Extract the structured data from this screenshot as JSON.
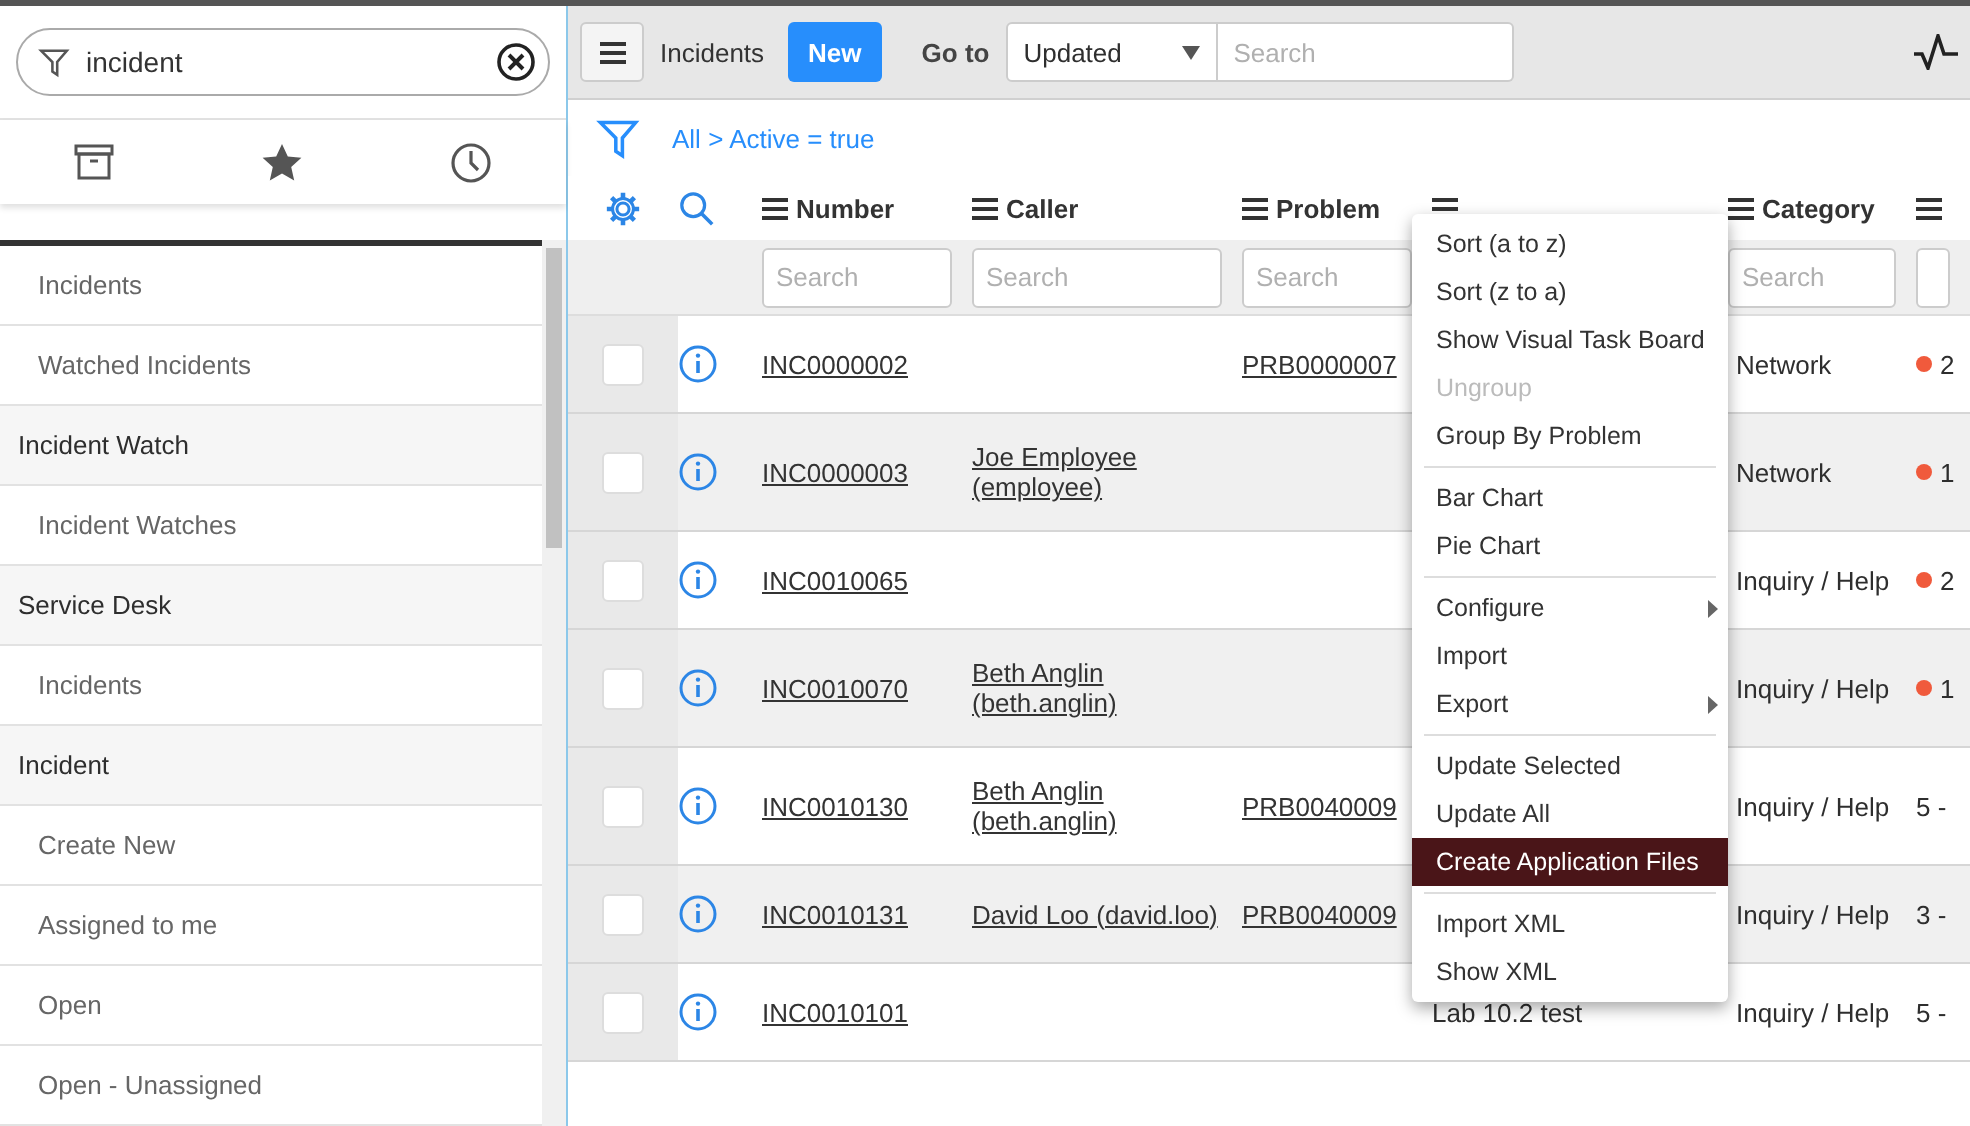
{
  "sidebar": {
    "filter": {
      "value": "incident"
    },
    "items": [
      {
        "kind": "module",
        "label": "Incidents"
      },
      {
        "kind": "module",
        "label": "Watched Incidents"
      },
      {
        "kind": "header",
        "label": "Incident Watch"
      },
      {
        "kind": "module",
        "label": "Incident Watches"
      },
      {
        "kind": "header",
        "label": "Service Desk"
      },
      {
        "kind": "module",
        "label": "Incidents"
      },
      {
        "kind": "header",
        "label": "Incident"
      },
      {
        "kind": "module",
        "label": "Create New"
      },
      {
        "kind": "module",
        "label": "Assigned to me"
      },
      {
        "kind": "module",
        "label": "Open"
      },
      {
        "kind": "module",
        "label": "Open - Unassigned"
      }
    ]
  },
  "toolbar": {
    "title": "Incidents",
    "new_button": "New",
    "goto_label": "Go to",
    "goto_field": "Updated",
    "search": {
      "placeholder": "Search"
    }
  },
  "breadcrumb": {
    "all": "All",
    "separator": ">",
    "condition": "Active = true"
  },
  "table": {
    "columns": [
      {
        "label": "Number",
        "placeholder": "Search"
      },
      {
        "label": "Caller",
        "placeholder": "Search"
      },
      {
        "label": "Problem",
        "placeholder": "Search"
      },
      {},
      {
        "label": "Category",
        "placeholder": "Search"
      },
      {}
    ],
    "rows": [
      {
        "checked": false,
        "number": "INC0000002",
        "problem": "PRB0000007",
        "category": "Network",
        "priority": {
          "text": "2",
          "color": "#f05a3c"
        }
      },
      {
        "checked": false,
        "number": "INC0000003",
        "caller": "Joe Employee (employee)",
        "category": "Network",
        "priority": {
          "text": "1",
          "color": "#f05a3c"
        }
      },
      {
        "checked": false,
        "number": "INC0010065",
        "category": "Inquiry / Help",
        "priority": {
          "text": "2",
          "color": "#f05a3c"
        }
      },
      {
        "checked": false,
        "number": "INC0010070",
        "caller": "Beth Anglin (beth.anglin)",
        "category": "Inquiry / Help",
        "priority": {
          "text": "1",
          "color": "#f05a3c"
        }
      },
      {
        "checked": false,
        "number": "INC0010130",
        "caller": "Beth Anglin (beth.anglin)",
        "problem": "PRB0040009",
        "category": "Inquiry / Help",
        "priority": {
          "text": "5 -"
        }
      },
      {
        "checked": false,
        "number": "INC0010131",
        "caller": "David Loo (david.loo)",
        "problem": "PRB0040009",
        "category": "Inquiry / Help",
        "priority": {
          "text": "3 -"
        }
      },
      {
        "checked": false,
        "number": "INC0010101",
        "short_description": "Lab 10.2 test",
        "category": "Inquiry / Help",
        "priority": {
          "text": "5 -"
        }
      }
    ]
  },
  "context_menu": {
    "groups": [
      [
        {
          "label": "Sort (a to z)",
          "disabled": false,
          "selected": false,
          "submenu": false
        },
        {
          "label": "Sort (z to a)",
          "disabled": false,
          "selected": false,
          "submenu": false
        },
        {
          "label": "Show Visual Task Board",
          "disabled": false,
          "selected": false,
          "submenu": false
        },
        {
          "label": "Ungroup",
          "disabled": true,
          "selected": false,
          "submenu": false
        },
        {
          "label": "Group By Problem",
          "disabled": false,
          "selected": false,
          "submenu": false
        }
      ],
      [
        {
          "label": "Bar Chart",
          "disabled": false,
          "selected": false,
          "submenu": false
        },
        {
          "label": "Pie Chart",
          "disabled": false,
          "selected": false,
          "submenu": false
        }
      ],
      [
        {
          "label": "Configure",
          "disabled": false,
          "selected": false,
          "submenu": true
        },
        {
          "label": "Import",
          "disabled": false,
          "selected": false,
          "submenu": false
        },
        {
          "label": "Export",
          "disabled": false,
          "selected": false,
          "submenu": true
        }
      ],
      [
        {
          "label": "Update Selected",
          "disabled": false,
          "selected": false,
          "submenu": false
        },
        {
          "label": "Update All",
          "disabled": false,
          "selected": false,
          "submenu": false
        },
        {
          "label": "Create Application Files",
          "disabled": false,
          "selected": true,
          "submenu": false
        }
      ],
      [
        {
          "label": "Import XML",
          "disabled": false,
          "selected": false,
          "submenu": false
        },
        {
          "label": "Show XML",
          "disabled": false,
          "selected": false,
          "submenu": false
        }
      ]
    ]
  }
}
